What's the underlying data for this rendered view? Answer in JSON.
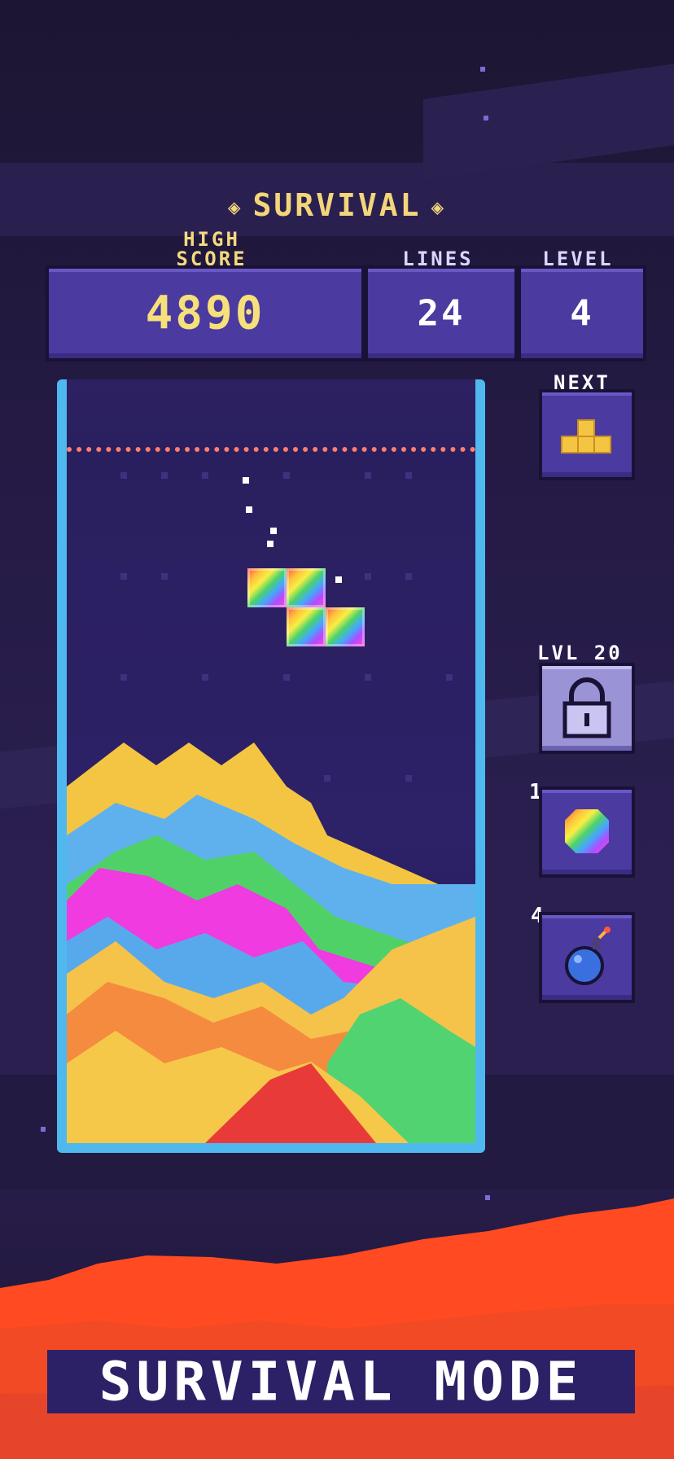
{
  "header": {
    "mode_title": "SURVIVAL",
    "high_score_label_line1": "HIGH",
    "high_score_label_line2": "SCORE",
    "lines_label": "LINES",
    "level_label": "LEVEL",
    "high_score_value": "4890",
    "lines_value": "24",
    "level_value": "4"
  },
  "side": {
    "next_label": "NEXT",
    "next_piece": "t-piece-icon",
    "locked_label": "LVL 20",
    "rainbow_powerup_count": "1",
    "bomb_powerup_count": "4"
  },
  "footer": {
    "banner_text": "SURVIVAL MODE"
  },
  "colors": {
    "accent_yellow": "#f6e07a",
    "panel_purple": "#4b3aa0",
    "board_frame": "#4fb8ef",
    "ground_red": "#ff4a22"
  }
}
